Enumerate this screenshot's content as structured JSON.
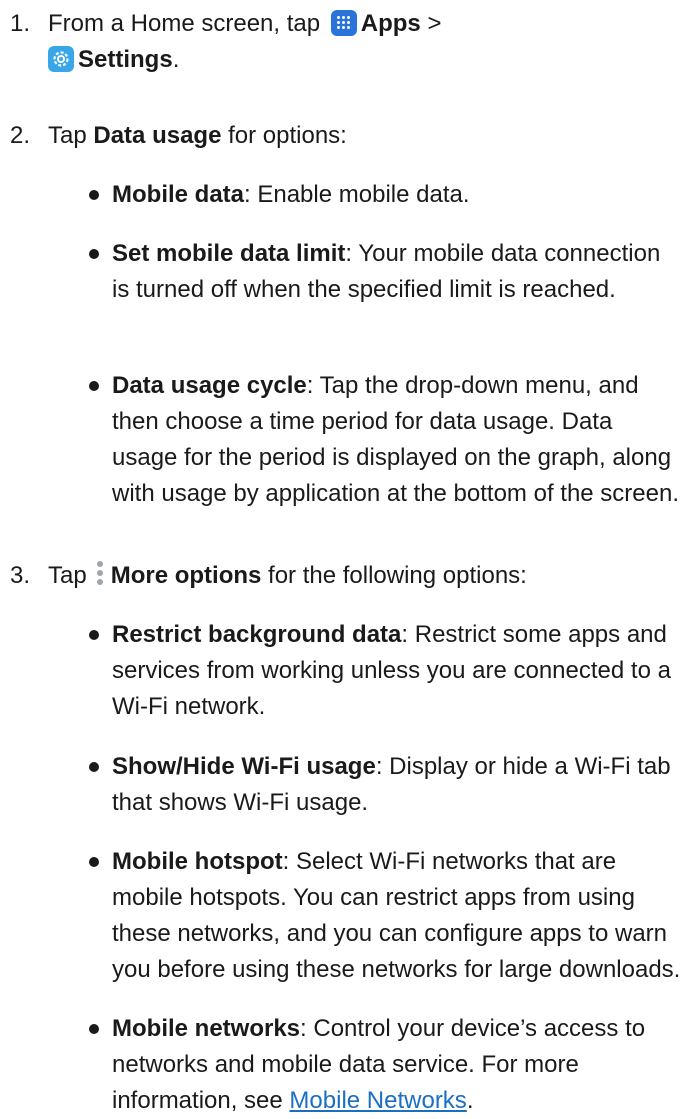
{
  "steps": [
    {
      "number": "1.",
      "pre": "From a Home screen, tap",
      "apps_label": "Apps",
      "sep": ">",
      "settings_label": "Settings",
      "post": ".",
      "icons": [
        "apps-icon",
        "settings-icon"
      ]
    },
    {
      "number": "2.",
      "pre": "Tap",
      "bold": "Data usage",
      "post": "for options:"
    },
    {
      "number": "3.",
      "pre": "Tap",
      "bold": "More options",
      "post": "for the following options:",
      "icons": [
        "more-options-icon"
      ]
    }
  ],
  "step2_bullets": [
    {
      "term": "Mobile data",
      "desc": ": Enable mobile data."
    },
    {
      "term": "Set mobile data limit",
      "desc": ": Your mobile data connection is turned off when the specified limit is reached."
    },
    {
      "term": "Data usage cycle",
      "desc": ": Tap the drop-down menu, and then choose a time period for data usage. Data usage for the period is displayed on the graph, along with usage by application at the bottom of the screen."
    }
  ],
  "step3_bullets": [
    {
      "term": "Restrict background data",
      "desc": ": Restrict some apps and services from working unless you are connected to a Wi-Fi network."
    },
    {
      "term": "Show/Hide Wi-Fi usage",
      "desc": ": Display or hide a Wi-Fi tab that shows Wi-Fi usage."
    },
    {
      "term": "Mobile hotspot",
      "desc": ": Select Wi-Fi networks that are mobile hotspots. You can restrict apps from using these networks, and you can configure apps to warn you before using these networks for large downloads."
    },
    {
      "term": "Mobile networks",
      "desc": ": Control your device’s access to networks and mobile data service. For more information, see ",
      "link": "Mobile Networks",
      "tail": "."
    }
  ],
  "colors": {
    "text": "#1a1a1a",
    "link": "#1a6fc4",
    "apps_icon_bg": "#2a73d8",
    "settings_icon_bg": "#38a6e8",
    "more_icon": "#9aa7ad"
  }
}
